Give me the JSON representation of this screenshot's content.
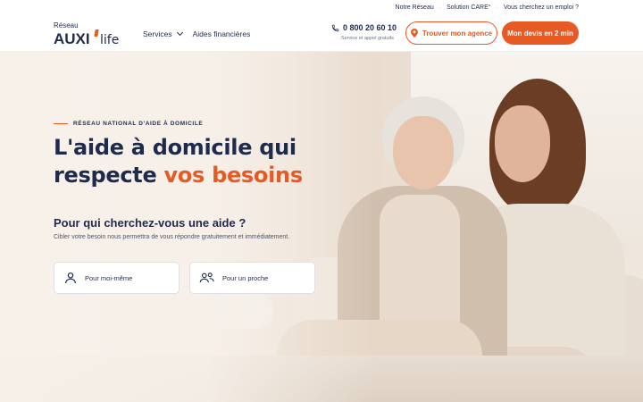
{
  "topbar": {
    "links": [
      "Notre Réseau",
      "Solution CARE°",
      "Vous cherchez un emploi ?"
    ]
  },
  "header": {
    "logo": {
      "top": "Réseau",
      "main": "AUXI",
      "suffix": "life"
    },
    "nav": {
      "services": "Services",
      "aides": "Aides financières"
    },
    "phone": {
      "number": "0 800 20 60 10",
      "note": "Service et appel gratuits"
    },
    "agence_button": "Trouver mon agence",
    "devis_button": "Mon devis en 2 min"
  },
  "hero": {
    "eyebrow": "RÉSEAU NATIONAL D'AIDE À DOMICILE",
    "title_line1": "L'aide à domicile qui",
    "title_line2_prefix": "respecte ",
    "title_line2_accent": "vos besoins",
    "question": "Pour qui cherchez-vous une aide ?",
    "question_sub": "Cibler votre besoin nous permettra de vous répondre gratuitement et immédiatement.",
    "choices": [
      {
        "label": "Pour moi-même",
        "icon": "user-icon"
      },
      {
        "label": "Pour un proche",
        "icon": "users-icon"
      }
    ]
  },
  "colors": {
    "accent": "#e85a24",
    "navy": "#1f2b4d"
  }
}
